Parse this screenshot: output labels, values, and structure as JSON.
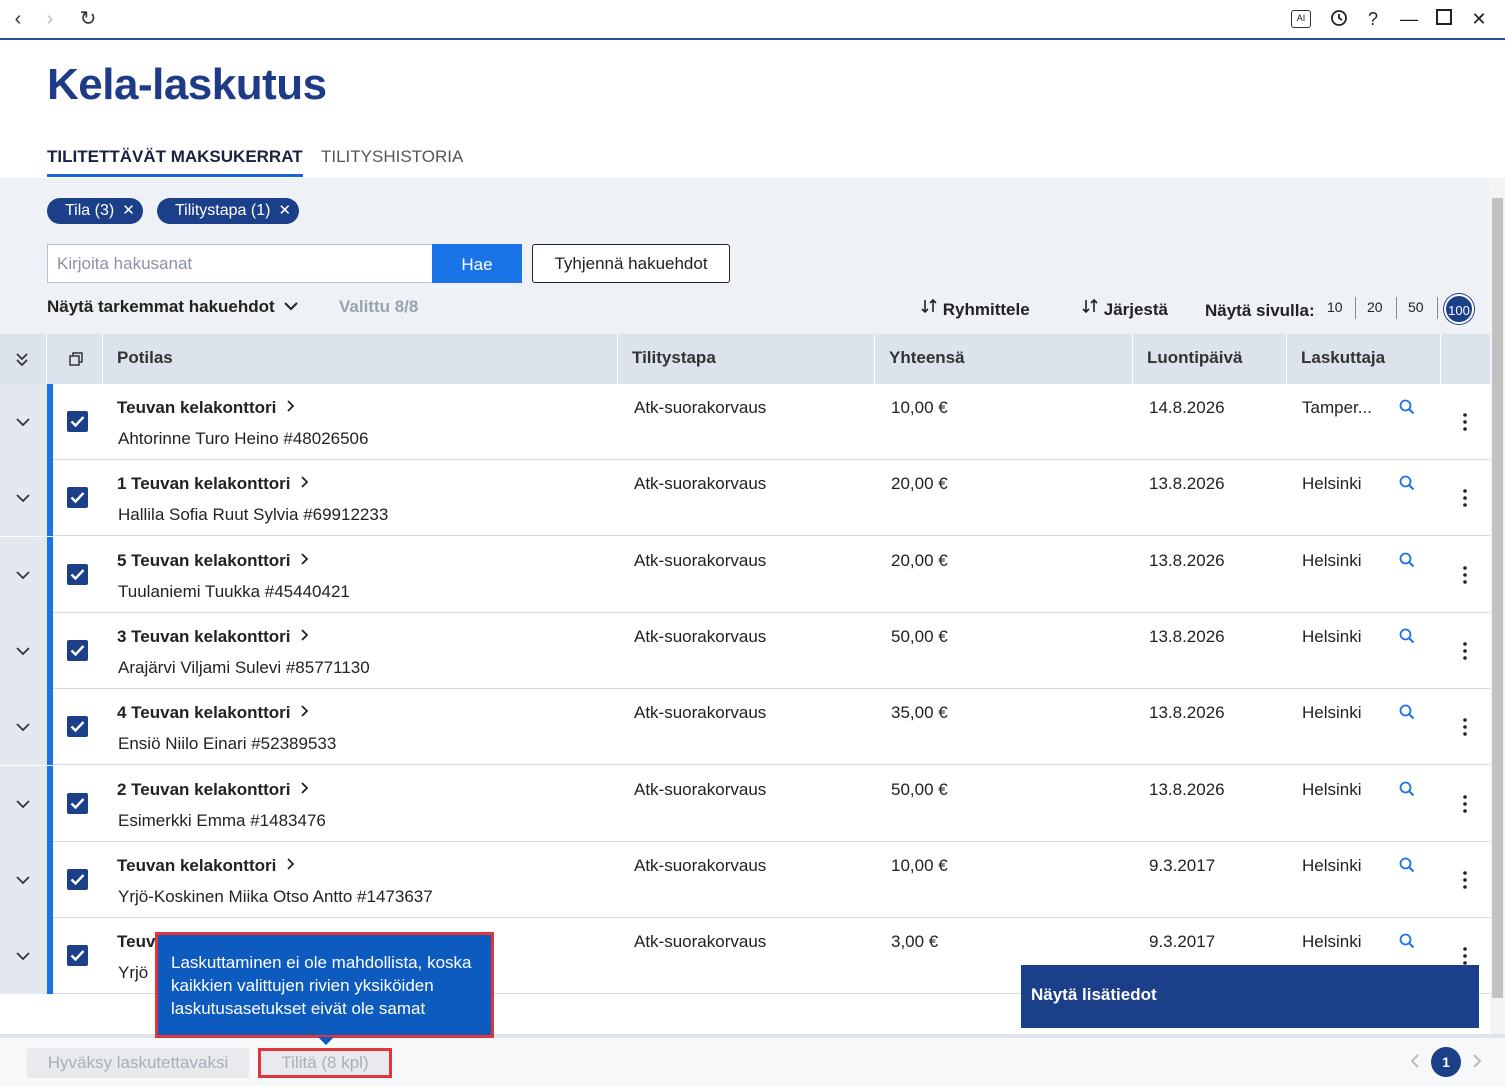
{
  "window": {
    "back_icon": "‹",
    "forward_icon": "›",
    "reload_icon": "↻",
    "ai_label": "AI",
    "help_icon": "?",
    "minimize_icon": "—",
    "close_icon": "✕"
  },
  "page_title": "Kela-laskutus",
  "tabs": [
    {
      "label": "TILITETTÄVÄT MAKSUKERRAT",
      "active": true
    },
    {
      "label": "TILITYSHISTORIA",
      "active": false
    }
  ],
  "filters": {
    "chips": [
      {
        "label": "Tila (3)"
      },
      {
        "label": "Tilitystapa (1)"
      }
    ],
    "chip_remove_icon": "✕",
    "search_placeholder": "Kirjoita hakusanat",
    "search_button": "Hae",
    "clear_button": "Tyhjennä hakuehdot",
    "advanced_label": "Näytä tarkemmat hakuehdot",
    "selected_label": "Valittu 8/8",
    "group_label": "Ryhmittele",
    "sort_label": "Järjestä",
    "per_page_label": "Näytä sivulla:",
    "per_page_options": [
      "10",
      "20",
      "50",
      "100"
    ],
    "per_page_selected": "100"
  },
  "table": {
    "columns": [
      "Potilas",
      "Tilitystapa",
      "Yhteensä",
      "Luontipäivä",
      "Laskuttaja"
    ],
    "rows": [
      {
        "office": "Teuvan kelakonttori",
        "patient": "Ahtorinne Turo Heino #48026506",
        "method": "Atk-suorakorvaus",
        "total": "10,00 €",
        "date": "14.8.2026",
        "biller": "Tamper...",
        "checked": true
      },
      {
        "office": "1 Teuvan kelakonttori",
        "patient": "Hallila Sofia Ruut Sylvia #69912233",
        "method": "Atk-suorakorvaus",
        "total": "20,00 €",
        "date": "13.8.2026",
        "biller": "Helsinki",
        "checked": true
      },
      {
        "office": "5 Teuvan kelakonttori",
        "patient": "Tuulaniemi Tuukka #45440421",
        "method": "Atk-suorakorvaus",
        "total": "20,00 €",
        "date": "13.8.2026",
        "biller": "Helsinki",
        "checked": true
      },
      {
        "office": "3 Teuvan kelakonttori",
        "patient": "Arajärvi Viljami Sulevi #85771130",
        "method": "Atk-suorakorvaus",
        "total": "50,00 €",
        "date": "13.8.2026",
        "biller": "Helsinki",
        "checked": true
      },
      {
        "office": "4 Teuvan kelakonttori",
        "patient": "Ensiö Niilo Einari #52389533",
        "method": "Atk-suorakorvaus",
        "total": "35,00 €",
        "date": "13.8.2026",
        "biller": "Helsinki",
        "checked": true
      },
      {
        "office": "2 Teuvan kelakonttori",
        "patient": "Esimerkki Emma #1483476",
        "method": "Atk-suorakorvaus",
        "total": "50,00 €",
        "date": "13.8.2026",
        "biller": "Helsinki",
        "checked": true
      },
      {
        "office": "Teuvan kelakonttori",
        "patient": "Yrjö-Koskinen Miika Otso Antto #1473637",
        "method": "Atk-suorakorvaus",
        "total": "10,00 €",
        "date": "9.3.2017",
        "biller": "Helsinki",
        "checked": true
      },
      {
        "office": "Teuva",
        "patient": "Yrjö",
        "method": "Atk-suorakorvaus",
        "total": "3,00 €",
        "date": "9.3.2017",
        "biller": "Helsinki",
        "checked": true
      }
    ]
  },
  "tooltip": "Laskuttaminen ei ole mahdollista, koska kaikkien valittujen rivien yksiköiden laskutusasetukset eivät ole samat",
  "details_panel": "Näytä lisätiedot",
  "footer": {
    "approve_button": "Hyväksy laskutettavaksi",
    "settle_button": "Tilitä (8 kpl)",
    "current_page": "1"
  },
  "colors": {
    "brand": "#1d3b86",
    "accent": "#1a74e8",
    "highlight": "#e0353b"
  }
}
